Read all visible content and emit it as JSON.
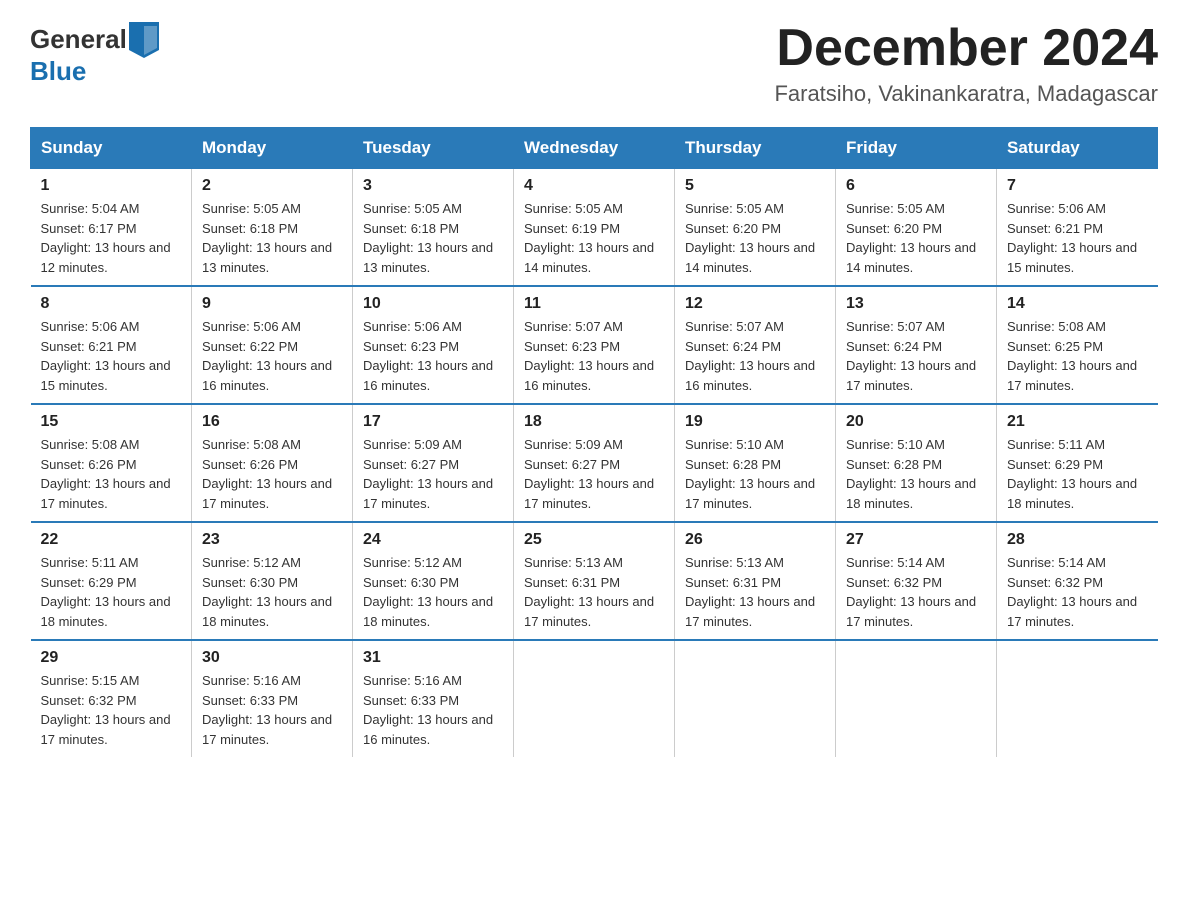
{
  "header": {
    "logo_general": "General",
    "logo_blue": "Blue",
    "title": "December 2024",
    "subtitle": "Faratsiho, Vakinankaratra, Madagascar"
  },
  "days_of_week": [
    "Sunday",
    "Monday",
    "Tuesday",
    "Wednesday",
    "Thursday",
    "Friday",
    "Saturday"
  ],
  "weeks": [
    [
      {
        "day": "1",
        "sunrise": "5:04 AM",
        "sunset": "6:17 PM",
        "daylight": "13 hours and 12 minutes."
      },
      {
        "day": "2",
        "sunrise": "5:05 AM",
        "sunset": "6:18 PM",
        "daylight": "13 hours and 13 minutes."
      },
      {
        "day": "3",
        "sunrise": "5:05 AM",
        "sunset": "6:18 PM",
        "daylight": "13 hours and 13 minutes."
      },
      {
        "day": "4",
        "sunrise": "5:05 AM",
        "sunset": "6:19 PM",
        "daylight": "13 hours and 14 minutes."
      },
      {
        "day": "5",
        "sunrise": "5:05 AM",
        "sunset": "6:20 PM",
        "daylight": "13 hours and 14 minutes."
      },
      {
        "day": "6",
        "sunrise": "5:05 AM",
        "sunset": "6:20 PM",
        "daylight": "13 hours and 14 minutes."
      },
      {
        "day": "7",
        "sunrise": "5:06 AM",
        "sunset": "6:21 PM",
        "daylight": "13 hours and 15 minutes."
      }
    ],
    [
      {
        "day": "8",
        "sunrise": "5:06 AM",
        "sunset": "6:21 PM",
        "daylight": "13 hours and 15 minutes."
      },
      {
        "day": "9",
        "sunrise": "5:06 AM",
        "sunset": "6:22 PM",
        "daylight": "13 hours and 16 minutes."
      },
      {
        "day": "10",
        "sunrise": "5:06 AM",
        "sunset": "6:23 PM",
        "daylight": "13 hours and 16 minutes."
      },
      {
        "day": "11",
        "sunrise": "5:07 AM",
        "sunset": "6:23 PM",
        "daylight": "13 hours and 16 minutes."
      },
      {
        "day": "12",
        "sunrise": "5:07 AM",
        "sunset": "6:24 PM",
        "daylight": "13 hours and 16 minutes."
      },
      {
        "day": "13",
        "sunrise": "5:07 AM",
        "sunset": "6:24 PM",
        "daylight": "13 hours and 17 minutes."
      },
      {
        "day": "14",
        "sunrise": "5:08 AM",
        "sunset": "6:25 PM",
        "daylight": "13 hours and 17 minutes."
      }
    ],
    [
      {
        "day": "15",
        "sunrise": "5:08 AM",
        "sunset": "6:26 PM",
        "daylight": "13 hours and 17 minutes."
      },
      {
        "day": "16",
        "sunrise": "5:08 AM",
        "sunset": "6:26 PM",
        "daylight": "13 hours and 17 minutes."
      },
      {
        "day": "17",
        "sunrise": "5:09 AM",
        "sunset": "6:27 PM",
        "daylight": "13 hours and 17 minutes."
      },
      {
        "day": "18",
        "sunrise": "5:09 AM",
        "sunset": "6:27 PM",
        "daylight": "13 hours and 17 minutes."
      },
      {
        "day": "19",
        "sunrise": "5:10 AM",
        "sunset": "6:28 PM",
        "daylight": "13 hours and 17 minutes."
      },
      {
        "day": "20",
        "sunrise": "5:10 AM",
        "sunset": "6:28 PM",
        "daylight": "13 hours and 18 minutes."
      },
      {
        "day": "21",
        "sunrise": "5:11 AM",
        "sunset": "6:29 PM",
        "daylight": "13 hours and 18 minutes."
      }
    ],
    [
      {
        "day": "22",
        "sunrise": "5:11 AM",
        "sunset": "6:29 PM",
        "daylight": "13 hours and 18 minutes."
      },
      {
        "day": "23",
        "sunrise": "5:12 AM",
        "sunset": "6:30 PM",
        "daylight": "13 hours and 18 minutes."
      },
      {
        "day": "24",
        "sunrise": "5:12 AM",
        "sunset": "6:30 PM",
        "daylight": "13 hours and 18 minutes."
      },
      {
        "day": "25",
        "sunrise": "5:13 AM",
        "sunset": "6:31 PM",
        "daylight": "13 hours and 17 minutes."
      },
      {
        "day": "26",
        "sunrise": "5:13 AM",
        "sunset": "6:31 PM",
        "daylight": "13 hours and 17 minutes."
      },
      {
        "day": "27",
        "sunrise": "5:14 AM",
        "sunset": "6:32 PM",
        "daylight": "13 hours and 17 minutes."
      },
      {
        "day": "28",
        "sunrise": "5:14 AM",
        "sunset": "6:32 PM",
        "daylight": "13 hours and 17 minutes."
      }
    ],
    [
      {
        "day": "29",
        "sunrise": "5:15 AM",
        "sunset": "6:32 PM",
        "daylight": "13 hours and 17 minutes."
      },
      {
        "day": "30",
        "sunrise": "5:16 AM",
        "sunset": "6:33 PM",
        "daylight": "13 hours and 17 minutes."
      },
      {
        "day": "31",
        "sunrise": "5:16 AM",
        "sunset": "6:33 PM",
        "daylight": "13 hours and 16 minutes."
      },
      null,
      null,
      null,
      null
    ]
  ]
}
